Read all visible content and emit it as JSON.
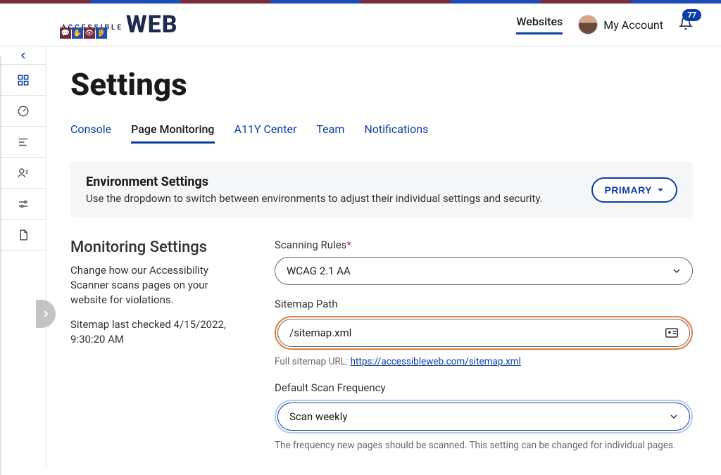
{
  "brand": {
    "small_text": "ACCESSIBLE",
    "big_text": "WEB"
  },
  "nav": {
    "websites": "Websites",
    "account": "My Account",
    "notifications_count": "77"
  },
  "page": {
    "title": "Settings"
  },
  "tabs": {
    "console": "Console",
    "page_monitoring": "Page Monitoring",
    "a11y_center": "A11Y Center",
    "team": "Team",
    "notifications": "Notifications"
  },
  "env": {
    "heading": "Environment Settings",
    "description": "Use the dropdown to switch between environments to adjust their individual settings and security.",
    "button": "PRIMARY"
  },
  "monitoring": {
    "heading": "Monitoring Settings",
    "description": "Change how our Accessibility Scanner scans pages on your website for violations.",
    "last_checked": "Sitemap last checked 4/15/2022, 9:30:20 AM"
  },
  "form": {
    "scanning_rules_label": "Scanning Rules",
    "scanning_rules_value": "WCAG 2.1 AA",
    "sitemap_label": "Sitemap Path",
    "sitemap_value": "/sitemap.xml",
    "sitemap_helper_prefix": "Full sitemap URL: ",
    "sitemap_url": "https://accessibleweb.com/sitemap.xml",
    "frequency_label": "Default Scan Frequency",
    "frequency_value": "Scan weekly",
    "frequency_helper": "The frequency new pages should be scanned. This setting can be changed for individual pages."
  },
  "decoration_colors": [
    "#7a2b3b",
    "#1e4db7",
    "#7a2b3b",
    "#1e4db7",
    "#7a2b3b",
    "#1e4db7",
    "#7a2b3b",
    "#1e4db7"
  ]
}
